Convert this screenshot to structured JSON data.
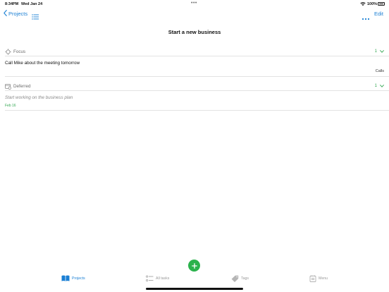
{
  "status_bar": {
    "time": "8:34PM",
    "date": "Wed Jan 24",
    "dots": "•••",
    "battery_pct": "100%"
  },
  "nav": {
    "back_label": "Projects",
    "edit_label": "Edit"
  },
  "page": {
    "title": "Start a new business"
  },
  "sections": [
    {
      "label": "Focus",
      "count": "1",
      "tasks": [
        {
          "title": "Call Mike about the meeting tomorrow",
          "tag": "Calls"
        }
      ]
    },
    {
      "label": "Deferred",
      "count": "1",
      "tasks": [
        {
          "title": "Start working on the business plan",
          "date": "Feb 16"
        }
      ]
    }
  ],
  "tab_bar": {
    "tabs": [
      {
        "label": "Projects",
        "icon": "book-icon",
        "active": true
      },
      {
        "label": "All tasks",
        "icon": "checklist-icon",
        "active": false
      },
      {
        "label": "Tags",
        "icon": "tag-icon",
        "active": false
      },
      {
        "label": "Menu",
        "icon": "notepad-icon",
        "active": false
      }
    ]
  },
  "colors": {
    "accent": "#1a7fd4",
    "green": "#34a853",
    "add_button": "#2bb24c"
  }
}
